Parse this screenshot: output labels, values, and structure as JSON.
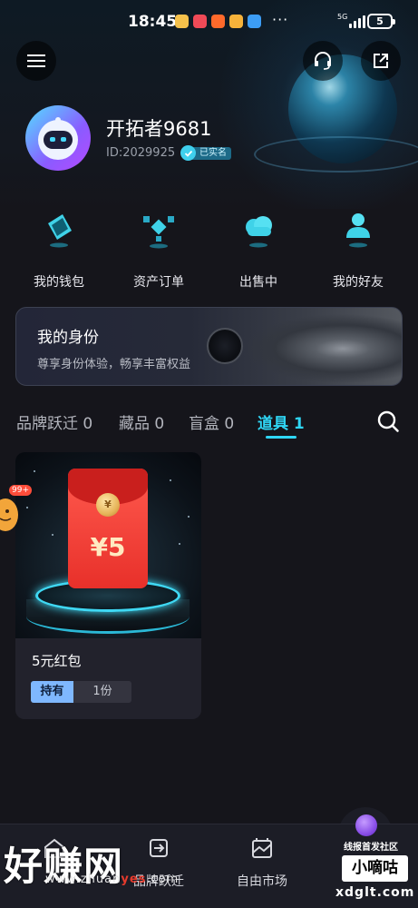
{
  "status_bar": {
    "time": "18:45",
    "network": "5G",
    "battery": "5",
    "overflow": "···"
  },
  "header": {
    "menu_icon": "menu-icon",
    "support_icon": "headset-icon",
    "share_icon": "share-icon"
  },
  "profile": {
    "username": "开拓者9681",
    "id": "ID:2029925",
    "verified_label": "已实名"
  },
  "quick_actions": [
    {
      "label": "我的钱包",
      "icon": "wallet-icon"
    },
    {
      "label": "资产订单",
      "icon": "cubes-icon"
    },
    {
      "label": "出售中",
      "icon": "cloud-icon"
    },
    {
      "label": "我的好友",
      "icon": "friend-icon"
    }
  ],
  "identity": {
    "title": "我的身份",
    "subtitle": "尊享身份体验，畅享丰富权益"
  },
  "tabs": [
    {
      "label": "品牌跃迁 0",
      "active": false
    },
    {
      "label": "藏品 0",
      "active": false
    },
    {
      "label": "盲盒 0",
      "active": false
    },
    {
      "label": "道具 1",
      "active": true
    }
  ],
  "items": [
    {
      "title": "5元红包",
      "envelope_amount": "¥5",
      "coin_text": "¥",
      "status": "持有",
      "quantity": "1份"
    }
  ],
  "floating": {
    "badge": "99+"
  },
  "bottom_nav": [
    {
      "label": "",
      "icon": "home-icon"
    },
    {
      "label": "品牌跃迁",
      "icon": "transition-icon"
    },
    {
      "label": "自由市场",
      "icon": "market-icon"
    },
    {
      "label": "",
      "icon": "profile-icon"
    }
  ],
  "watermark": {
    "left_text": "好赚网",
    "url_prefix": "www.zhuan",
    "url_highlight": "yes",
    "url_suffix": ".com",
    "right_top": "线报首发社区",
    "right_box": "小嘀咕",
    "right_url": "xdglt.com"
  },
  "colors": {
    "accent": "#2fd6f5",
    "background": "#15151b",
    "badge_blue": "#7fb8ff",
    "red_envelope": "#e8302a"
  }
}
